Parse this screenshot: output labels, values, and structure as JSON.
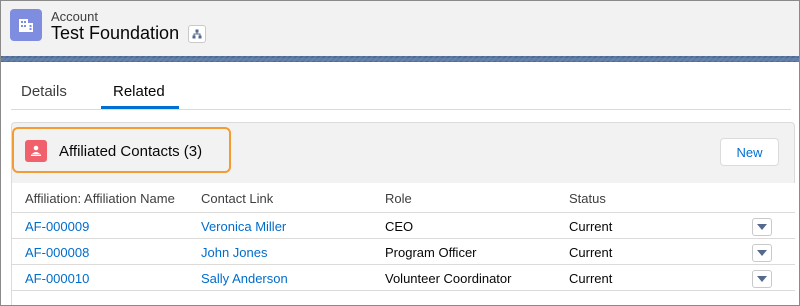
{
  "header": {
    "object_label": "Account",
    "record_title": "Test Foundation"
  },
  "tabs": [
    {
      "label": "Details",
      "active": false
    },
    {
      "label": "Related",
      "active": true
    }
  ],
  "related_list": {
    "title": "Affiliated Contacts (3)",
    "new_label": "New",
    "columns": [
      "Affiliation: Affiliation Name",
      "Contact Link",
      "Role",
      "Status"
    ],
    "rows": [
      {
        "name": "AF-000009",
        "contact": "Veronica Miller",
        "role": "CEO",
        "status": "Current"
      },
      {
        "name": "AF-000008",
        "contact": "John Jones",
        "role": "Program Officer",
        "status": "Current"
      },
      {
        "name": "AF-000010",
        "contact": "Sally Anderson",
        "role": "Volunteer Coordinator",
        "status": "Current"
      }
    ]
  },
  "colors": {
    "account_icon": "#7f8de1",
    "contacts_icon": "#f0616b",
    "highlight": "#f39c33",
    "link": "#006dcc",
    "tab_active": "#0070d2"
  }
}
